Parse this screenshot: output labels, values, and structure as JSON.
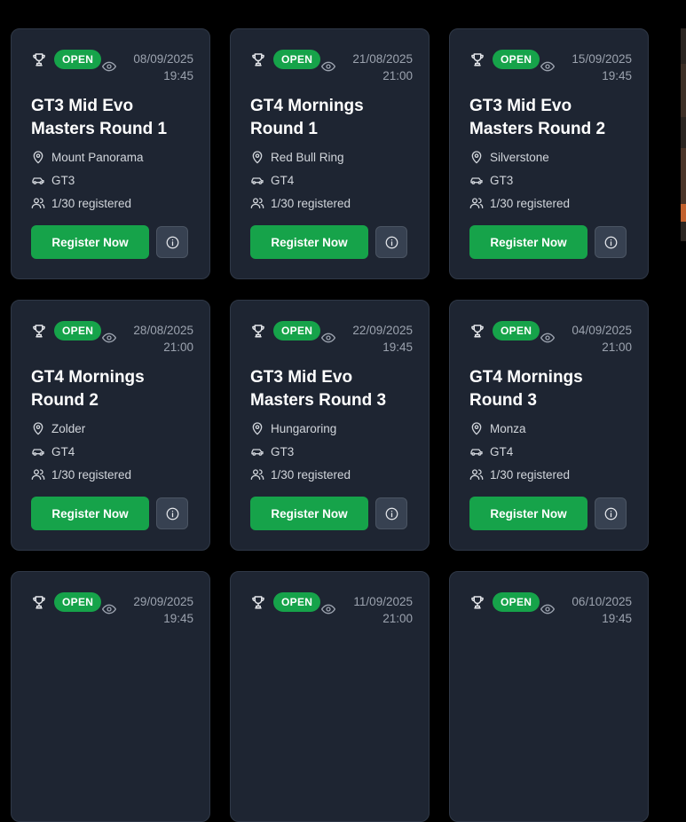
{
  "events": [
    {
      "status": "OPEN",
      "date": "08/09/2025",
      "time": "19:45",
      "title": "GT3 Mid Evo Masters Round 1",
      "track": "Mount Panorama",
      "car_class": "GT3",
      "registered": "1/30 registered",
      "register_label": "Register Now"
    },
    {
      "status": "OPEN",
      "date": "21/08/2025",
      "time": "21:00",
      "title": "GT4 Mornings Round 1",
      "track": "Red Bull Ring",
      "car_class": "GT4",
      "registered": "1/30 registered",
      "register_label": "Register Now"
    },
    {
      "status": "OPEN",
      "date": "15/09/2025",
      "time": "19:45",
      "title": "GT3 Mid Evo Masters Round 2",
      "track": "Silverstone",
      "car_class": "GT3",
      "registered": "1/30 registered",
      "register_label": "Register Now"
    },
    {
      "status": "OPEN",
      "date": "28/08/2025",
      "time": "21:00",
      "title": "GT4 Mornings Round 2",
      "track": "Zolder",
      "car_class": "GT4",
      "registered": "1/30 registered",
      "register_label": "Register Now"
    },
    {
      "status": "OPEN",
      "date": "22/09/2025",
      "time": "19:45",
      "title": "GT3 Mid Evo Masters Round 3",
      "track": "Hungaroring",
      "car_class": "GT3",
      "registered": "1/30 registered",
      "register_label": "Register Now"
    },
    {
      "status": "OPEN",
      "date": "04/09/2025",
      "time": "21:00",
      "title": "GT4 Mornings Round 3",
      "track": "Monza",
      "car_class": "GT4",
      "registered": "1/30 registered",
      "register_label": "Register Now"
    },
    {
      "status": "OPEN",
      "date": "29/09/2025",
      "time": "19:45"
    },
    {
      "status": "OPEN",
      "date": "11/09/2025",
      "time": "21:00"
    },
    {
      "status": "OPEN",
      "date": "06/10/2025",
      "time": "19:45"
    }
  ],
  "icons": {
    "trophy": "trophy-icon",
    "views": "eye-icon",
    "track": "map-pin-icon",
    "car_class": "car-icon",
    "registered": "users-icon",
    "details": "info-icon"
  },
  "colors": {
    "background": "#000000",
    "card": "#1e2532",
    "card_border": "#2f3847",
    "accent_green": "#16a34a",
    "muted_text": "#9ca3af",
    "title_text": "#ffffff"
  }
}
